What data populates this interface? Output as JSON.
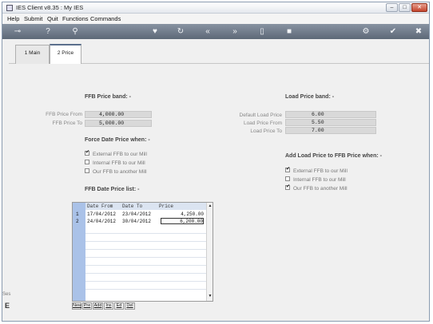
{
  "window": {
    "title": "IES Client v8.35 : My IES"
  },
  "menu": [
    "Help",
    "Submit",
    "Quit",
    "Functions",
    "Commands"
  ],
  "tabs": [
    {
      "label": "1 Main",
      "active": false
    },
    {
      "label": "2 Price",
      "active": true
    }
  ],
  "ffb_band": {
    "title": "FFB Price band: -",
    "from_label": "FFB Price From",
    "from_value": "4,000.00",
    "to_label": "FFB Price To",
    "to_value": "5,000.00"
  },
  "load_band": {
    "title": "Load Price band: -",
    "default_label": "Default Load Price",
    "default_value": "6.00",
    "from_label": "Load Price From",
    "from_value": "5.50",
    "to_label": "Load Price To",
    "to_value": "7.00"
  },
  "force_date": {
    "title": "Force Date Price when: -",
    "options": [
      {
        "label": "External FFB to our Mill",
        "checked": true
      },
      {
        "label": "Internal FFB to our Mill",
        "checked": false
      },
      {
        "label": "Our FFB to another Mill",
        "checked": false
      }
    ]
  },
  "add_load": {
    "title": "Add Load Price to FFB Price when: -",
    "options": [
      {
        "label": "External FFB to our Mill",
        "checked": true
      },
      {
        "label": "Internal FFB to our Mill",
        "checked": false
      },
      {
        "label": "Our FFB to another Mill",
        "checked": true
      }
    ]
  },
  "date_list": {
    "title": "FFB Date Price list: -",
    "columns": [
      "Date From",
      "Date To",
      "Price"
    ],
    "rows": [
      {
        "num": "1",
        "from": "17/04/2012",
        "to": "23/04/2012",
        "price": "4,250.00"
      },
      {
        "num": "2",
        "from": "24/04/2012",
        "to": "30/04/2012",
        "price": "6,200.00"
      }
    ],
    "buttons": [
      "New",
      "Pre",
      "Add",
      "Ins",
      "Ed",
      "Del"
    ]
  },
  "side": {
    "label": "Ses",
    "mark": "E"
  }
}
